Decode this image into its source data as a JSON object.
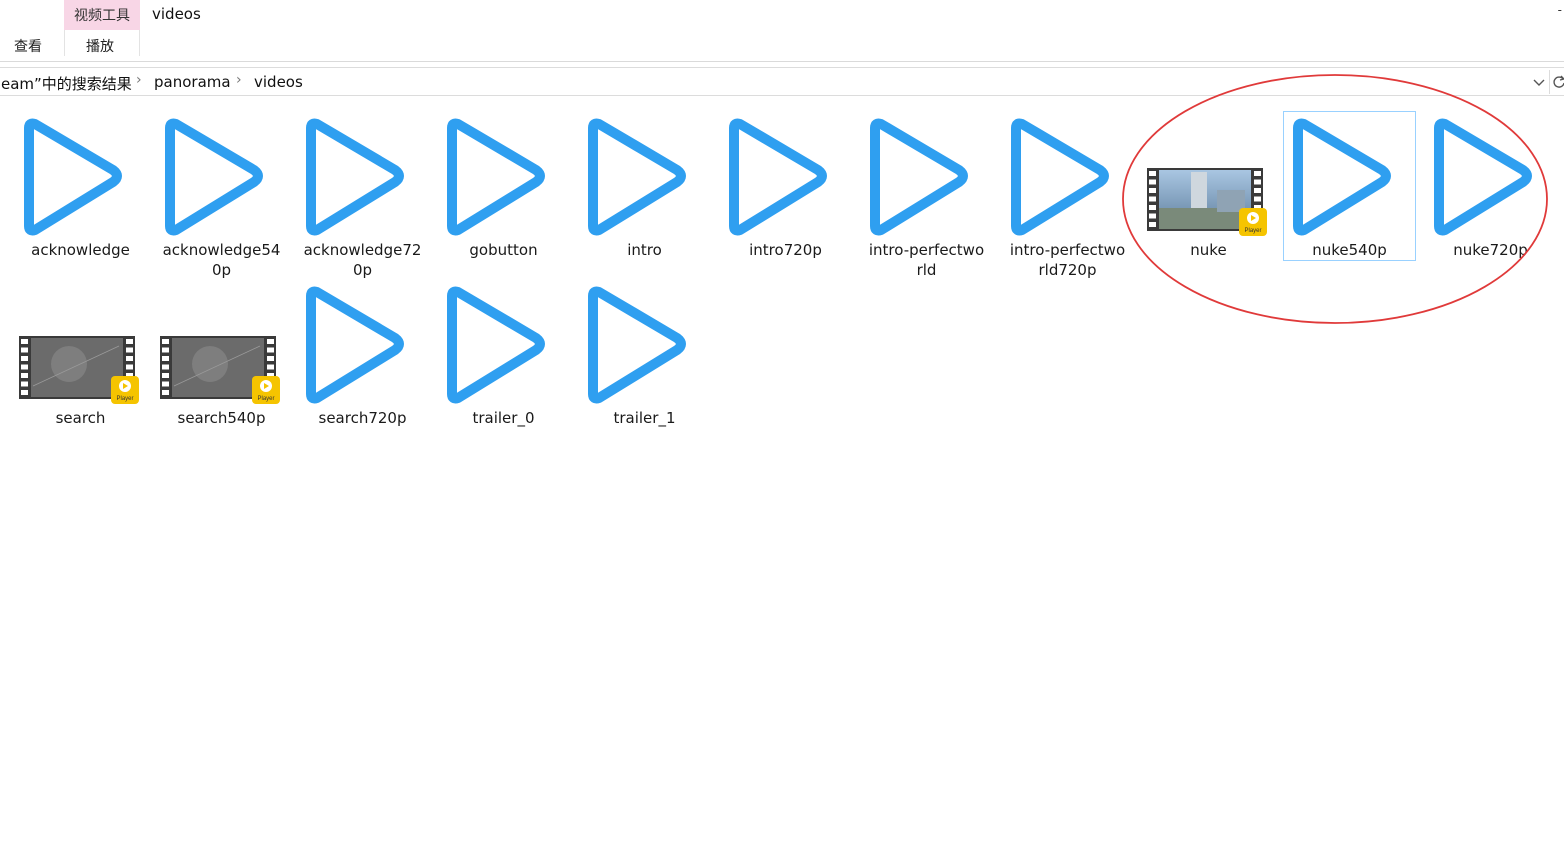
{
  "ribbon": {
    "tool_group_label": "视频工具",
    "window_title": "videos",
    "tab_view": "查看",
    "tab_play": "播放",
    "title_dash": "-"
  },
  "address": {
    "crumbs": [
      "eam”中的搜索结果",
      "panorama",
      "videos"
    ],
    "sep_icon": "chevron-right-icon",
    "dropdown_icon": "chevron-down-icon",
    "refresh_icon": "refresh-icon"
  },
  "colors": {
    "play_icon": "#2f9ff0",
    "annotation": "#e03a3a",
    "tool_group_bg": "#f8d6e6",
    "selection_border": "#99d1ff"
  },
  "files": [
    {
      "name": "acknowledge",
      "line1": "acknowledge",
      "line2": "",
      "icon": "play-icon"
    },
    {
      "name": "acknowledge540p",
      "line1": "acknowledge54",
      "line2": "0p",
      "icon": "play-icon"
    },
    {
      "name": "acknowledge720p",
      "line1": "acknowledge72",
      "line2": "0p",
      "icon": "play-icon"
    },
    {
      "name": "gobutton",
      "line1": "gobutton",
      "line2": "",
      "icon": "play-icon"
    },
    {
      "name": "intro",
      "line1": "intro",
      "line2": "",
      "icon": "play-icon"
    },
    {
      "name": "intro720p",
      "line1": "intro720p",
      "line2": "",
      "icon": "play-icon"
    },
    {
      "name": "intro-perfectworld",
      "line1": "intro-perfectwo",
      "line2": "rld",
      "icon": "play-icon"
    },
    {
      "name": "intro-perfectworld720p",
      "line1": "intro-perfectwo",
      "line2": "rld720p",
      "icon": "play-icon"
    },
    {
      "name": "nuke",
      "line1": "nuke",
      "line2": "",
      "icon": "video-thumbnail",
      "thumb_label": "Player"
    },
    {
      "name": "nuke540p",
      "line1": "nuke540p",
      "line2": "",
      "icon": "play-icon",
      "selected": true
    },
    {
      "name": "nuke720p",
      "line1": "nuke720p",
      "line2": "",
      "icon": "play-icon"
    },
    {
      "name": "search",
      "line1": "search",
      "line2": "",
      "icon": "video-thumbnail",
      "thumb_label": "Player"
    },
    {
      "name": "search540p",
      "line1": "search540p",
      "line2": "",
      "icon": "video-thumbnail",
      "thumb_label": "Player"
    },
    {
      "name": "search720p",
      "line1": "search720p",
      "line2": "",
      "icon": "play-icon"
    },
    {
      "name": "trailer_0",
      "line1": "trailer_0",
      "line2": "",
      "icon": "play-icon"
    },
    {
      "name": "trailer_1",
      "line1": "trailer_1",
      "line2": "",
      "icon": "play-icon"
    }
  ]
}
